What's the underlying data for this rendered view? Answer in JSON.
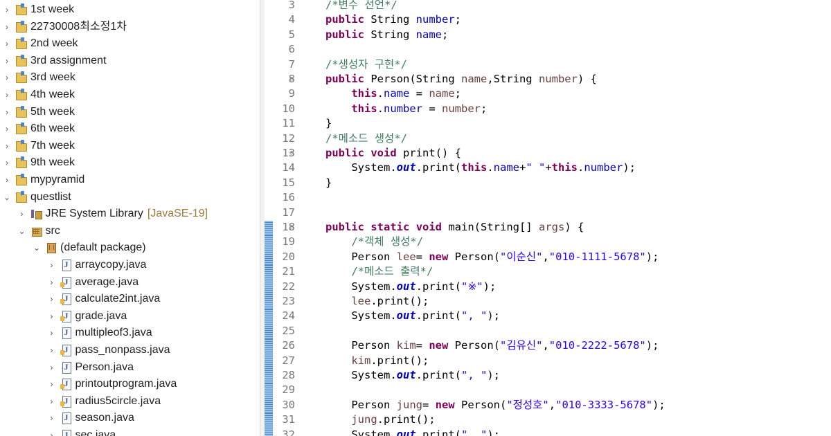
{
  "explorer": {
    "items": [
      {
        "label": "1st week",
        "icon": "java-project-icon",
        "twisty": "chevron-right",
        "level": 0
      },
      {
        "label": "22730008최소정1차",
        "icon": "java-project-icon",
        "twisty": "chevron-right",
        "level": 0
      },
      {
        "label": "2nd week",
        "icon": "java-project-icon",
        "twisty": "chevron-right",
        "level": 0
      },
      {
        "label": "3rd assignment",
        "icon": "java-project-icon",
        "twisty": "chevron-right",
        "level": 0
      },
      {
        "label": "3rd week",
        "icon": "java-project-icon",
        "twisty": "chevron-right",
        "level": 0
      },
      {
        "label": "4th week",
        "icon": "java-project-icon",
        "twisty": "chevron-right",
        "level": 0
      },
      {
        "label": "5th week",
        "icon": "java-project-icon",
        "twisty": "chevron-right",
        "level": 0
      },
      {
        "label": "6th week",
        "icon": "java-project-icon",
        "twisty": "chevron-right",
        "level": 0
      },
      {
        "label": "7th week",
        "icon": "java-project-icon",
        "twisty": "chevron-right",
        "level": 0
      },
      {
        "label": "9th week",
        "icon": "java-project-icon",
        "twisty": "chevron-right",
        "level": 0
      },
      {
        "label": "mypyramid",
        "icon": "java-project-icon",
        "twisty": "chevron-right",
        "level": 0
      },
      {
        "label": "questlist",
        "icon": "java-project-icon",
        "twisty": "chevron-down",
        "level": 0
      },
      {
        "label": "JRE System Library",
        "decoration": "[JavaSE-19]",
        "icon": "library-icon",
        "twisty": "chevron-right",
        "level": 1
      },
      {
        "label": "src",
        "icon": "source-folder-icon",
        "twisty": "chevron-down",
        "level": 1
      },
      {
        "label": "(default package)",
        "icon": "package-icon",
        "twisty": "chevron-down",
        "level": 2
      },
      {
        "label": "arraycopy.java",
        "icon": "java-file-icon",
        "twisty": "chevron-right",
        "level": 3
      },
      {
        "label": "average.java",
        "icon": "java-file-icon",
        "twisty": "chevron-right",
        "level": 3,
        "modified": true
      },
      {
        "label": "calculate2int.java",
        "icon": "java-file-icon",
        "twisty": "chevron-right",
        "level": 3,
        "modified": true
      },
      {
        "label": "grade.java",
        "icon": "java-file-icon",
        "twisty": "chevron-right",
        "level": 3,
        "modified": true
      },
      {
        "label": "multipleof3.java",
        "icon": "java-file-icon",
        "twisty": "chevron-right",
        "level": 3
      },
      {
        "label": "pass_nonpass.java",
        "icon": "java-file-icon",
        "twisty": "chevron-right",
        "level": 3,
        "modified": true
      },
      {
        "label": "Person.java",
        "icon": "java-file-icon",
        "twisty": "chevron-right",
        "level": 3
      },
      {
        "label": "printoutprogram.java",
        "icon": "java-file-icon",
        "twisty": "chevron-right",
        "level": 3,
        "modified": true
      },
      {
        "label": "radius5circle.java",
        "icon": "java-file-icon",
        "twisty": "chevron-right",
        "level": 3,
        "modified": true
      },
      {
        "label": "season.java",
        "icon": "java-file-icon",
        "twisty": "chevron-right",
        "level": 3
      },
      {
        "label": "sec.java",
        "icon": "java-file-icon",
        "twisty": "chevron-right",
        "level": 3
      }
    ]
  },
  "editor": {
    "lines": [
      {
        "n": "3",
        "tokens": [
          [
            "cm",
            "/*변수 선언*/"
          ]
        ]
      },
      {
        "n": "4",
        "tokens": [
          [
            "kw",
            "public"
          ],
          [
            "",
            " String "
          ],
          [
            "fld",
            "number"
          ],
          [
            "",
            ";"
          ]
        ]
      },
      {
        "n": "5",
        "tokens": [
          [
            "kw",
            "public"
          ],
          [
            "",
            " String "
          ],
          [
            "fld",
            "name"
          ],
          [
            "",
            ";"
          ]
        ]
      },
      {
        "n": "6",
        "tokens": []
      },
      {
        "n": "7",
        "tokens": [
          [
            "cm",
            "/*생성자 구현*/"
          ]
        ]
      },
      {
        "n": "8",
        "fold": true,
        "tokens": [
          [
            "kw",
            "public"
          ],
          [
            "",
            " Person(String "
          ],
          [
            "par",
            "name"
          ],
          [
            "",
            ",String "
          ],
          [
            "par",
            "number"
          ],
          [
            "",
            ") {"
          ]
        ]
      },
      {
        "n": "9",
        "tokens": [
          [
            "",
            "    "
          ],
          [
            "kw",
            "this"
          ],
          [
            "",
            "."
          ],
          [
            "fld",
            "name"
          ],
          [
            "",
            " = "
          ],
          [
            "par",
            "name"
          ],
          [
            "",
            ";"
          ]
        ]
      },
      {
        "n": "10",
        "tokens": [
          [
            "",
            "    "
          ],
          [
            "kw",
            "this"
          ],
          [
            "",
            "."
          ],
          [
            "fld",
            "number"
          ],
          [
            "",
            " = "
          ],
          [
            "par",
            "number"
          ],
          [
            "",
            ";"
          ]
        ]
      },
      {
        "n": "11",
        "tokens": [
          [
            "",
            "}"
          ]
        ]
      },
      {
        "n": "12",
        "tokens": [
          [
            "cm",
            "/*메소드 생성*/"
          ]
        ]
      },
      {
        "n": "13",
        "fold": true,
        "tokens": [
          [
            "kw",
            "public"
          ],
          [
            "",
            " "
          ],
          [
            "kw",
            "void"
          ],
          [
            "",
            " print() {"
          ]
        ]
      },
      {
        "n": "14",
        "tokens": [
          [
            "",
            "    System."
          ],
          [
            "sf",
            "out"
          ],
          [
            "",
            ".print("
          ],
          [
            "kw",
            "this"
          ],
          [
            "",
            "."
          ],
          [
            "fld",
            "name"
          ],
          [
            "",
            "+"
          ],
          [
            "str",
            "\" \""
          ],
          [
            "",
            "+"
          ],
          [
            "kw",
            "this"
          ],
          [
            "",
            "."
          ],
          [
            "fld",
            "number"
          ],
          [
            "",
            ");"
          ]
        ]
      },
      {
        "n": "15",
        "tokens": [
          [
            "",
            "}"
          ]
        ]
      },
      {
        "n": "16",
        "tokens": []
      },
      {
        "n": "17",
        "tokens": []
      },
      {
        "n": "18",
        "fold": true,
        "changed": true,
        "tokens": [
          [
            "kw",
            "public"
          ],
          [
            "",
            " "
          ],
          [
            "kw",
            "static"
          ],
          [
            "",
            " "
          ],
          [
            "kw",
            "void"
          ],
          [
            "",
            " main(String[] "
          ],
          [
            "par",
            "args"
          ],
          [
            "",
            ") {"
          ]
        ]
      },
      {
        "n": "19",
        "changed": true,
        "tokens": [
          [
            "",
            "    "
          ],
          [
            "cm",
            "/*객체 생성*/"
          ]
        ]
      },
      {
        "n": "20",
        "changed": true,
        "tokens": [
          [
            "",
            "    Person "
          ],
          [
            "par",
            "lee"
          ],
          [
            "",
            "= "
          ],
          [
            "kw",
            "new"
          ],
          [
            "",
            " Person("
          ],
          [
            "str",
            "\"이순신\""
          ],
          [
            "",
            ","
          ],
          [
            "str",
            "\"010-1111-5678\""
          ],
          [
            "",
            ");"
          ]
        ]
      },
      {
        "n": "21",
        "changed": true,
        "tokens": [
          [
            "",
            "    "
          ],
          [
            "cm",
            "/*메소드 출력*/"
          ]
        ]
      },
      {
        "n": "22",
        "changed": true,
        "tokens": [
          [
            "",
            "    System."
          ],
          [
            "sf",
            "out"
          ],
          [
            "",
            ".print("
          ],
          [
            "str",
            "\"※\""
          ],
          [
            "",
            ");"
          ]
        ]
      },
      {
        "n": "23",
        "changed": true,
        "tokens": [
          [
            "",
            "    "
          ],
          [
            "par",
            "lee"
          ],
          [
            "",
            ".print();"
          ]
        ]
      },
      {
        "n": "24",
        "changed": true,
        "tokens": [
          [
            "",
            "    System."
          ],
          [
            "sf",
            "out"
          ],
          [
            "",
            ".print("
          ],
          [
            "str",
            "\", \""
          ],
          [
            "",
            ");"
          ]
        ]
      },
      {
        "n": "25",
        "changed": true,
        "tokens": []
      },
      {
        "n": "26",
        "changed": true,
        "tokens": [
          [
            "",
            "    Person "
          ],
          [
            "par",
            "kim"
          ],
          [
            "",
            "= "
          ],
          [
            "kw",
            "new"
          ],
          [
            "",
            " Person("
          ],
          [
            "str",
            "\"김유신\""
          ],
          [
            "",
            ","
          ],
          [
            "str",
            "\"010-2222-5678\""
          ],
          [
            "",
            ");"
          ]
        ]
      },
      {
        "n": "27",
        "changed": true,
        "tokens": [
          [
            "",
            "    "
          ],
          [
            "par",
            "kim"
          ],
          [
            "",
            ".print();"
          ]
        ]
      },
      {
        "n": "28",
        "changed": true,
        "tokens": [
          [
            "",
            "    System."
          ],
          [
            "sf",
            "out"
          ],
          [
            "",
            ".print("
          ],
          [
            "str",
            "\", \""
          ],
          [
            "",
            ");"
          ]
        ]
      },
      {
        "n": "29",
        "changed": true,
        "tokens": []
      },
      {
        "n": "30",
        "changed": true,
        "tokens": [
          [
            "",
            "    Person "
          ],
          [
            "par",
            "jung"
          ],
          [
            "",
            "= "
          ],
          [
            "kw",
            "new"
          ],
          [
            "",
            " Person("
          ],
          [
            "str",
            "\"정성호\""
          ],
          [
            "",
            ","
          ],
          [
            "str",
            "\"010-3333-5678\""
          ],
          [
            "",
            ");"
          ]
        ]
      },
      {
        "n": "31",
        "changed": true,
        "tokens": [
          [
            "",
            "    "
          ],
          [
            "par",
            "jung"
          ],
          [
            "",
            ".print();"
          ]
        ]
      },
      {
        "n": "32",
        "changed": true,
        "tokens": [
          [
            "",
            "    System."
          ],
          [
            "sf",
            "out"
          ],
          [
            "",
            ".print("
          ],
          [
            "str",
            "\", \""
          ],
          [
            "",
            ");"
          ]
        ]
      }
    ]
  }
}
